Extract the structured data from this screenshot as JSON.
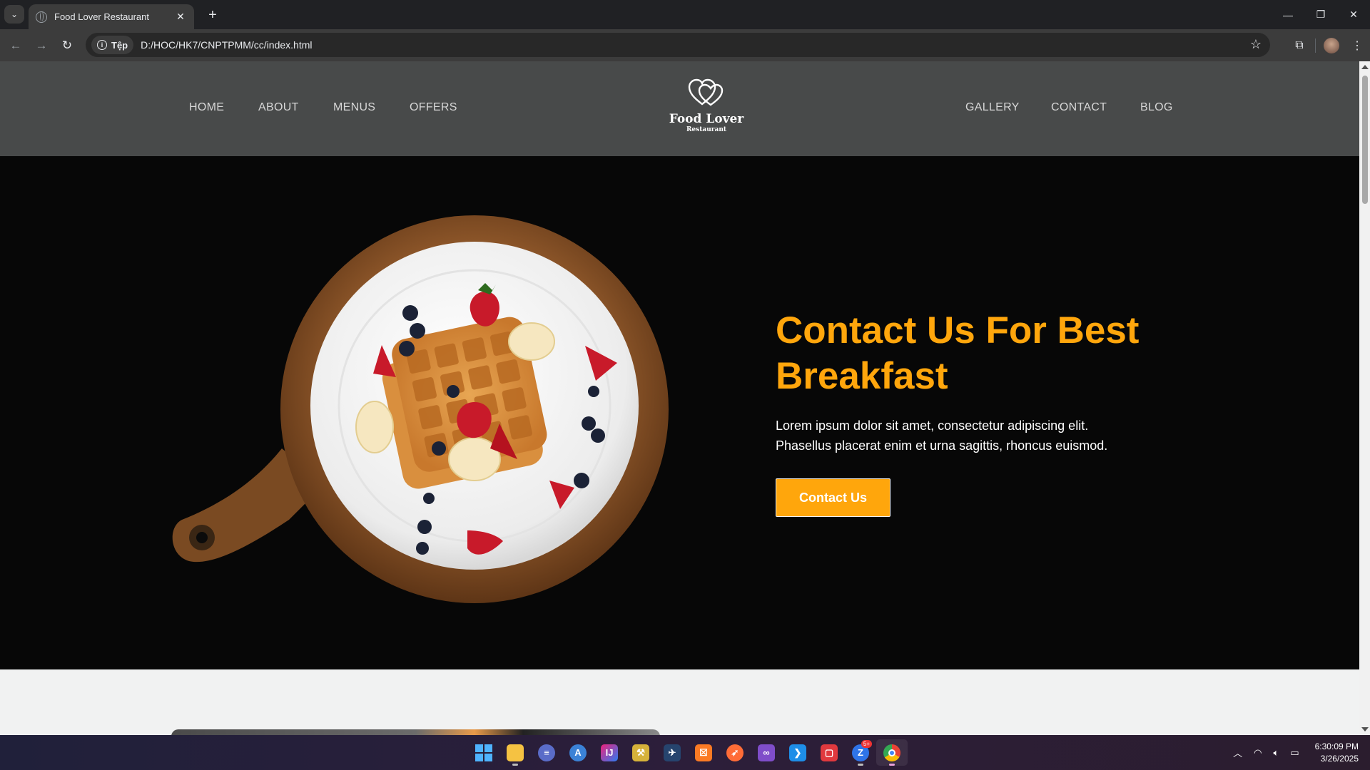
{
  "browser": {
    "tab_title": "Food Lover Restaurant",
    "site_chip_label": "Tệp",
    "url": "D:/HOC/HK7/CNPTPMM/cc/index.html"
  },
  "site": {
    "nav_left": [
      "HOME",
      "ABOUT",
      "MENUS",
      "OFFERS"
    ],
    "nav_right": [
      "GALLERY",
      "CONTACT",
      "BLOG"
    ],
    "logo_main": "Food Lover",
    "logo_sub": "Restaurant",
    "hero_title": "Contact Us For Best Breakfast",
    "hero_desc_line1": "Lorem ipsum dolor sit amet, consectetur adipiscing elit.",
    "hero_desc_line2": "Phasellus placerat enim et urna sagittis, rhoncus euismod.",
    "hero_button": "Contact Us",
    "accent_color": "#ffa60c",
    "header_bg": "#484a4a",
    "hero_bg": "#070707"
  },
  "taskbar": {
    "apps": [
      "windows-start-icon",
      "file-explorer-icon",
      "app-launcher-icon",
      "android-studio-icon",
      "intellij-icon",
      "sourcetree-icon",
      "ssms-icon",
      "xampp-icon",
      "postman-icon",
      "visual-studio-icon",
      "vscode-icon",
      "office-icon",
      "zalo-icon",
      "chrome-icon"
    ],
    "zalo_badge": "5+",
    "time": "6:30:09 PM",
    "date": "3/26/2025"
  }
}
